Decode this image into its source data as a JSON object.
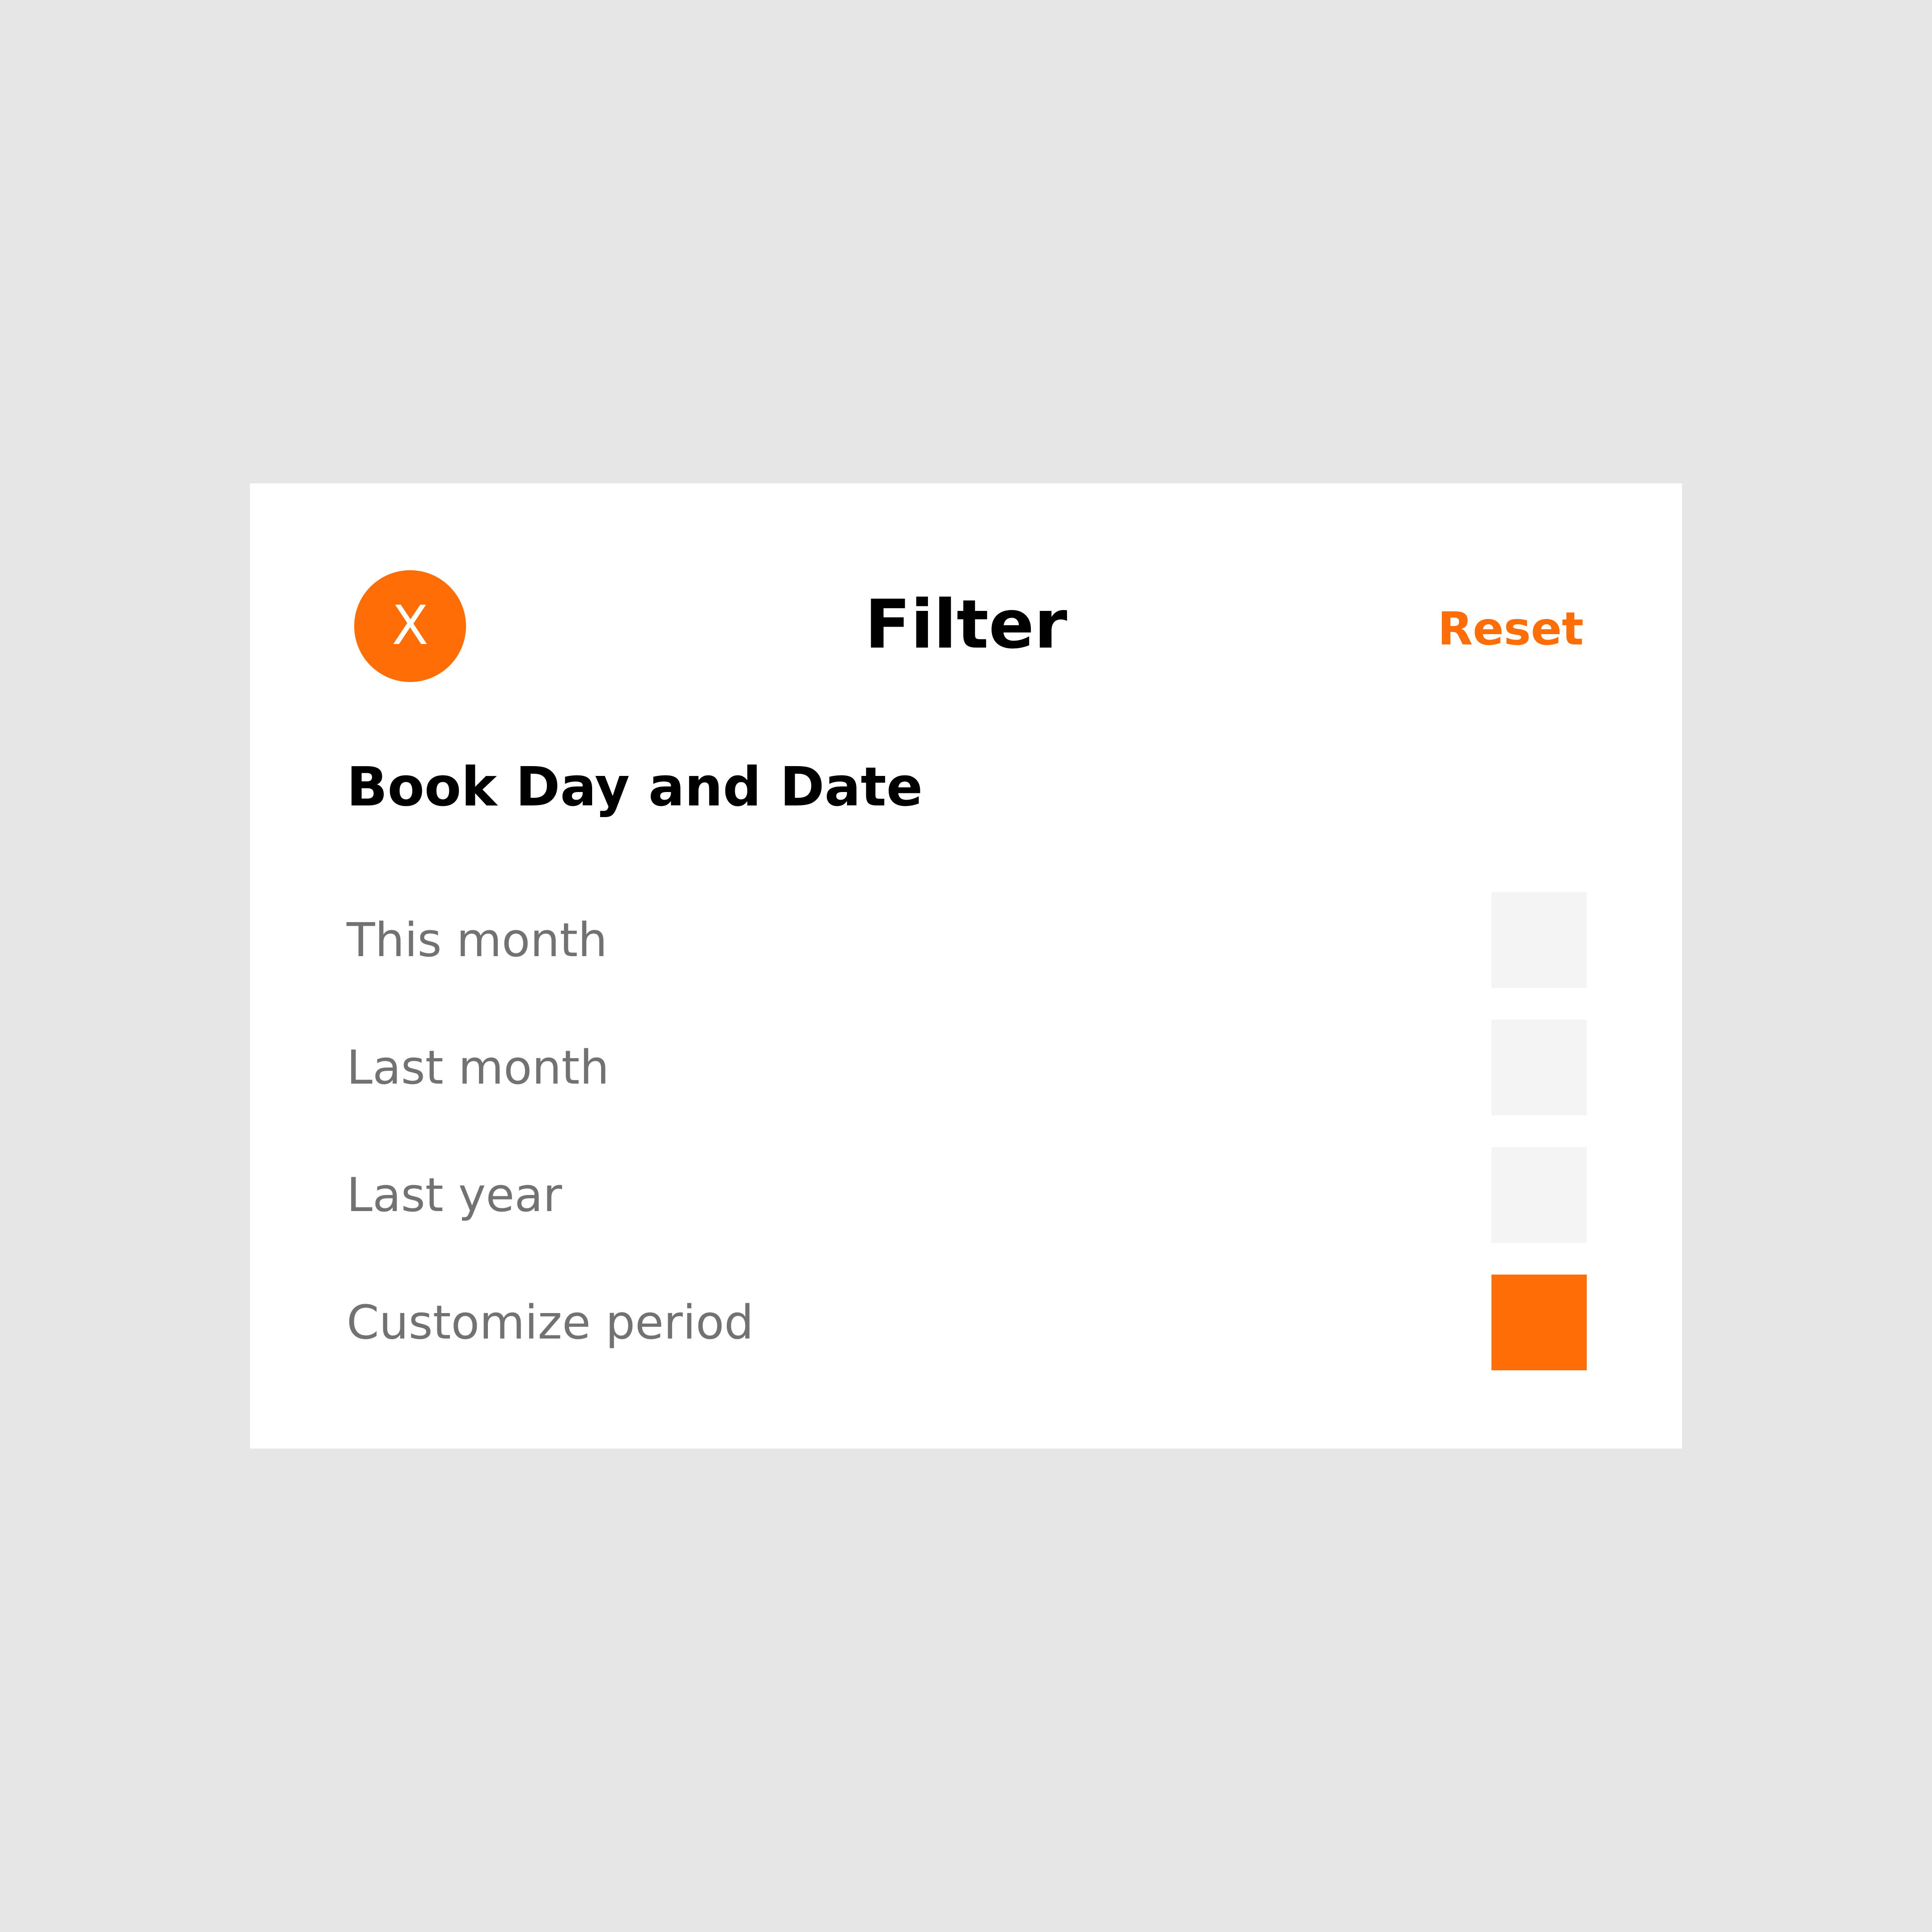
{
  "header": {
    "close_glyph": "X",
    "title": "Filter",
    "reset_label": "Reset"
  },
  "section": {
    "heading": "Book Day and Date",
    "options": [
      {
        "label": "This month",
        "selected": false
      },
      {
        "label": "Last month",
        "selected": false
      },
      {
        "label": "Last year",
        "selected": false
      },
      {
        "label": "Customize period",
        "selected": true
      }
    ]
  },
  "colors": {
    "accent": "#ff6d06",
    "unselected_box": "#f4f4f4",
    "background": "#e6e6e6",
    "panel": "#ffffff",
    "label_text": "#727272"
  }
}
